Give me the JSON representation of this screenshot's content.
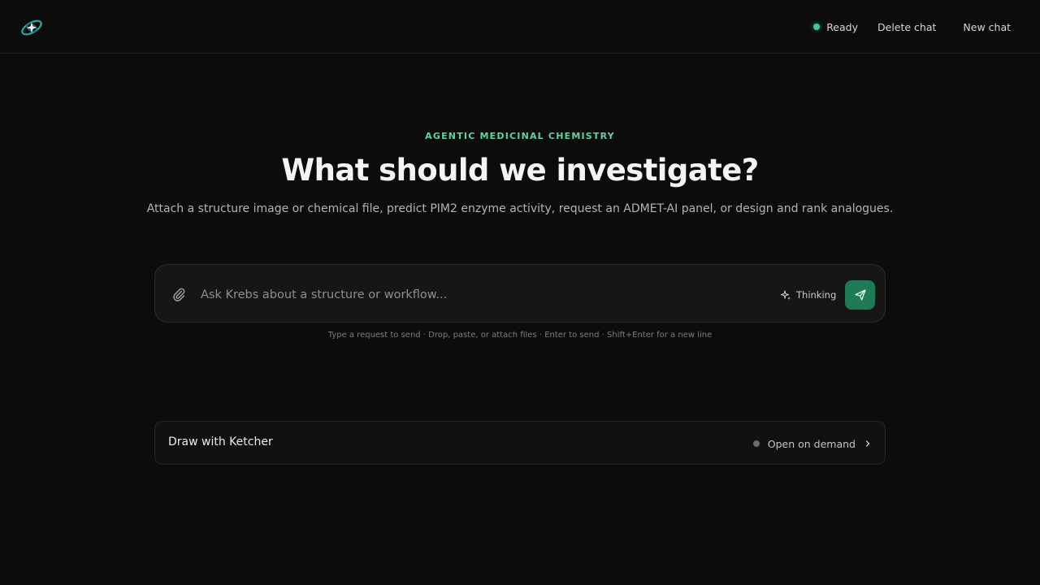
{
  "header": {
    "logo_icon": "atom-orbit-icon",
    "status_label": "Ready",
    "status_color": "#3ecf8e",
    "delete_chat_label": "Delete chat",
    "new_chat_label": "New chat"
  },
  "hero": {
    "eyebrow": "AGENTIC MEDICINAL CHEMISTRY",
    "headline": "What should we investigate?",
    "subhead": "Attach a structure image or chemical file, predict PIM2 enzyme activity, request an ADMET-AI panel, or design and rank analogues."
  },
  "composer": {
    "attach_icon": "paperclip-icon",
    "input_value": "",
    "input_placeholder": "Ask Krebs about a structure or workflow...",
    "thinking_icon": "sparkle-icon",
    "thinking_label": "Thinking",
    "send_icon": "paper-plane-icon",
    "accent_color": "#1f7a56",
    "hint": "Type a request to send · Drop, paste, or attach files · Enter to send · Shift+Enter for a new line"
  },
  "ketcher_panel": {
    "title": "Draw with Ketcher",
    "status_label": "Open on demand",
    "chevron_icon": "chevron-right-icon"
  }
}
